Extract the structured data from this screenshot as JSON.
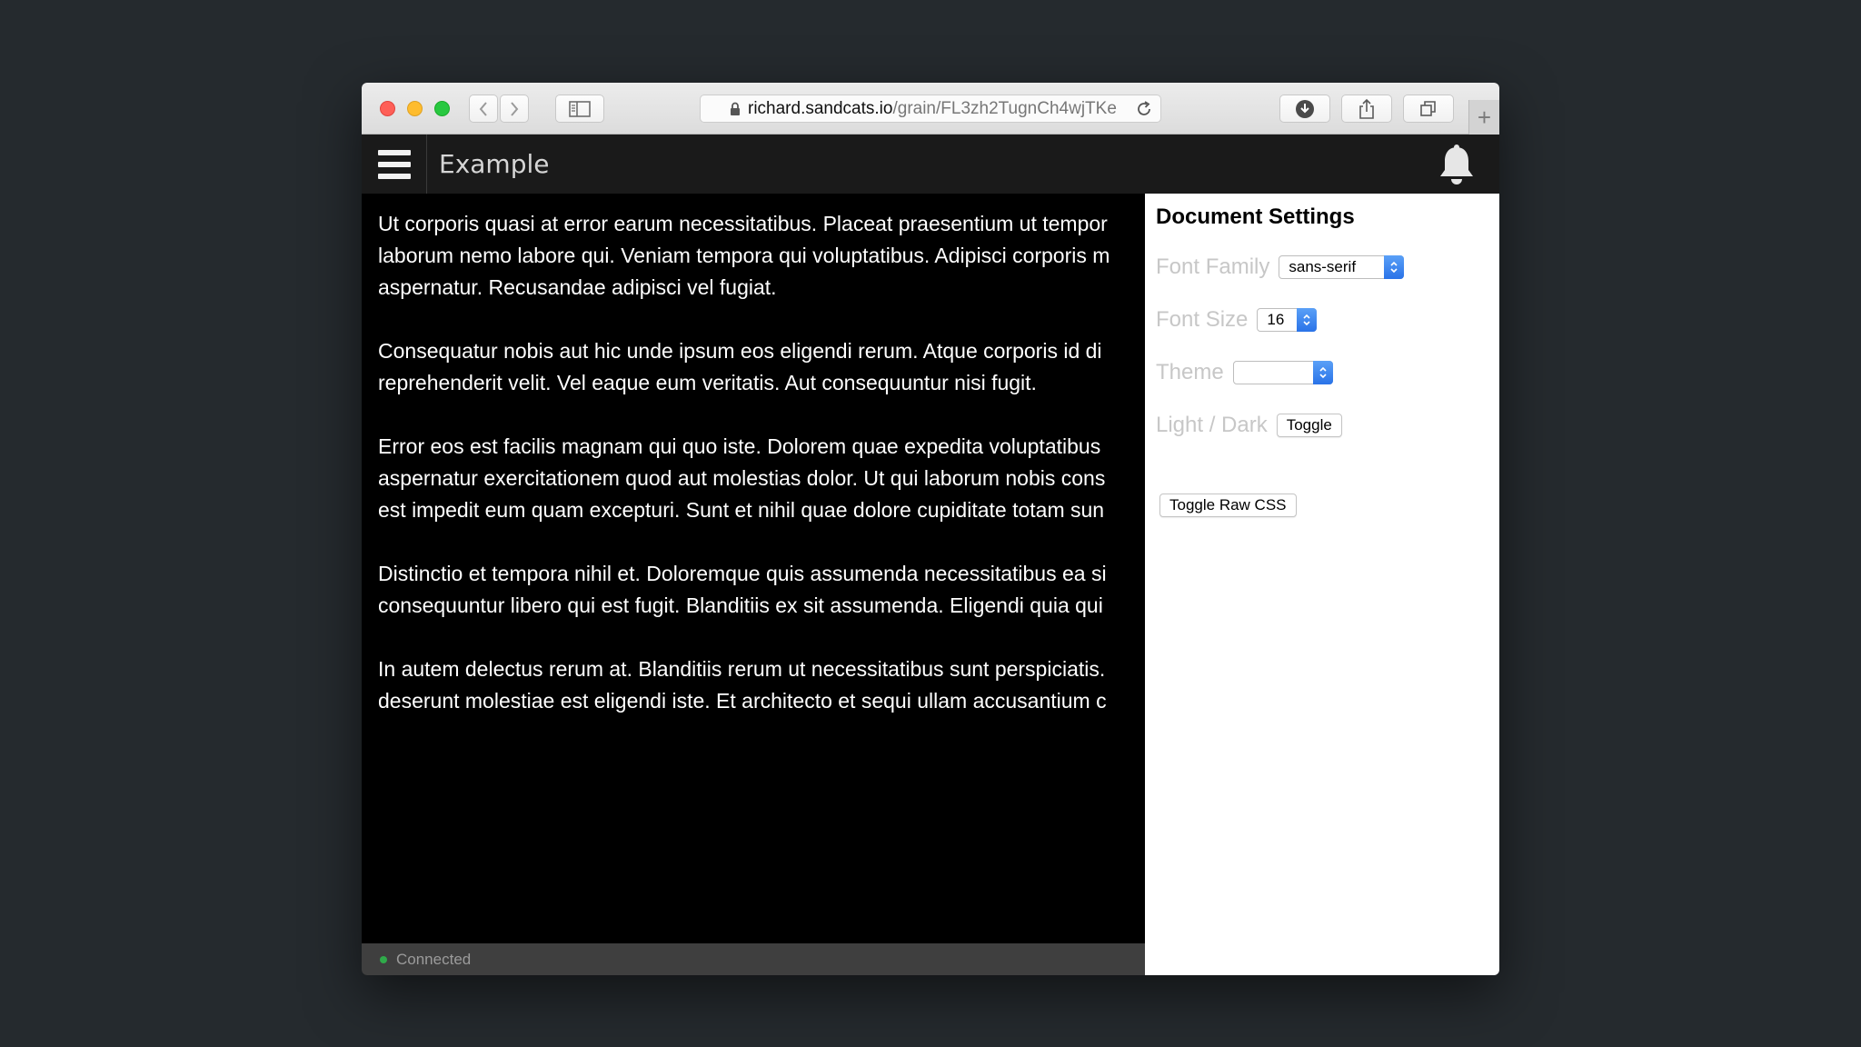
{
  "browser": {
    "url_host": "richard.sandcats.io",
    "url_path": "/grain/FL3zh2TugnCh4wjTKe",
    "icons": {
      "back": "chevron-left-icon",
      "forward": "chevron-right-icon",
      "sidebar": "sidebar-icon",
      "lock": "lock-icon",
      "reload": "reload-icon",
      "download": "download-icon",
      "share": "share-icon",
      "tabs": "tabs-icon",
      "new_tab": "plus-icon"
    },
    "new_tab_glyph": "+"
  },
  "app": {
    "title": "Example"
  },
  "document": {
    "paragraphs": [
      "Ut corporis quasi at error earum necessitatibus. Placeat praesentium ut tempor",
      "laborum nemo labore qui. Veniam tempora qui voluptatibus. Adipisci corporis m",
      "aspernatur. Recusandae adipisci vel fugiat.",
      "Consequatur nobis aut hic unde ipsum eos eligendi rerum. Atque corporis id di",
      "reprehenderit velit. Vel eaque eum veritatis. Aut consequuntur nisi fugit.",
      "Error eos est facilis magnam qui quo iste. Dolorem quae expedita voluptatibus",
      "aspernatur exercitationem quod aut molestias dolor. Ut qui laborum nobis cons",
      "est impedit eum quam excepturi. Sunt et nihil quae dolore cupiditate totam sun",
      "Distinctio et tempora nihil et. Doloremque quis assumenda necessitatibus ea si",
      "consequuntur libero qui est fugit. Blanditiis ex sit assumenda. Eligendi quia qui",
      "In autem delectus rerum at. Blanditiis rerum ut necessitatibus sunt perspiciatis.",
      "deserunt molestiae est eligendi iste. Et architecto et sequi ullam accusantium c"
    ]
  },
  "status": {
    "label": "Connected",
    "color": "#2faa4a"
  },
  "settings": {
    "title": "Document Settings",
    "font_family": {
      "label": "Font Family",
      "value": "sans-serif"
    },
    "font_size": {
      "label": "Font Size",
      "value": "16"
    },
    "theme": {
      "label": "Theme",
      "value": ""
    },
    "light_dark": {
      "label": "Light / Dark",
      "button": "Toggle"
    },
    "raw_css_button": "Toggle Raw CSS"
  },
  "colors": {
    "accent": "#2a73e8"
  }
}
